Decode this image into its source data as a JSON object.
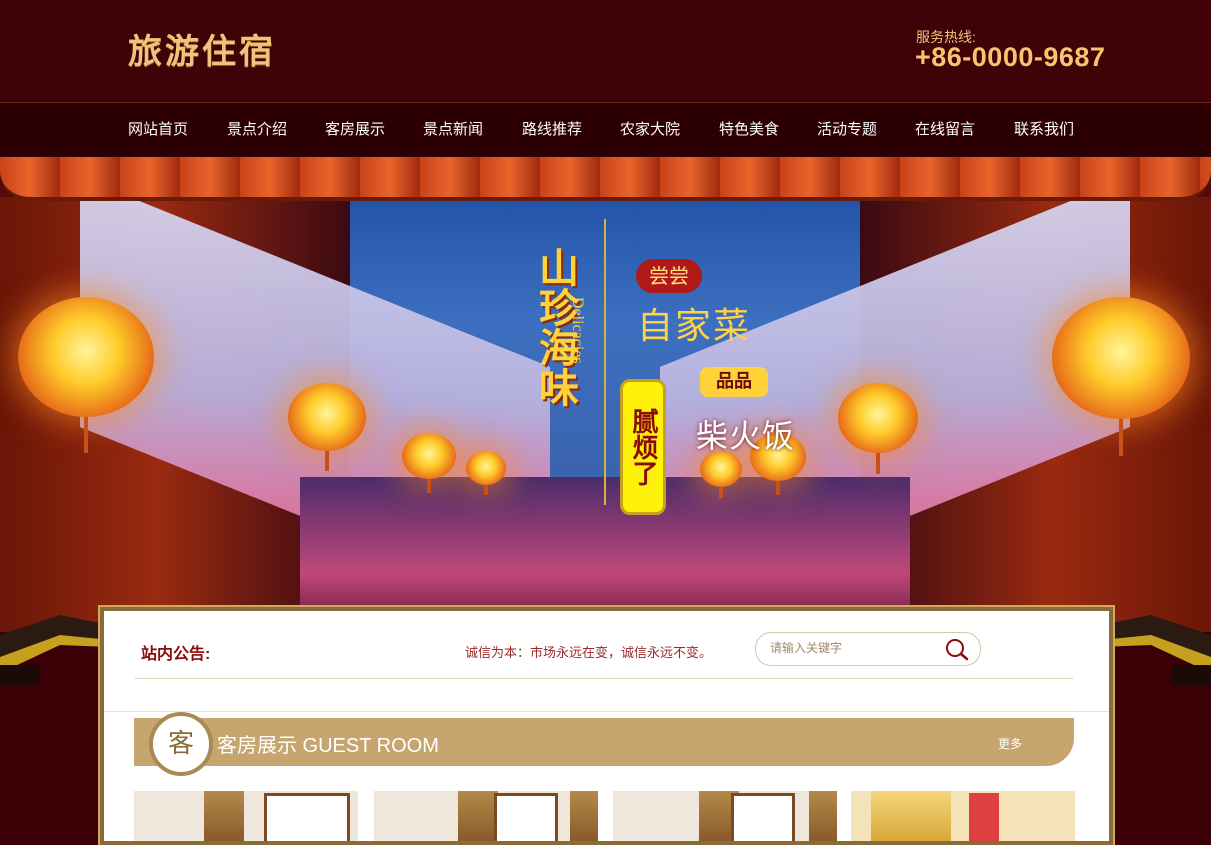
{
  "header": {
    "logo": "旅游住宿",
    "hotline_label": "服务热线:",
    "hotline_number": "+86-0000-9687"
  },
  "nav": {
    "items": [
      "网站首页",
      "景点介绍",
      "客房展示",
      "景点新闻",
      "路线推荐",
      "农家大院",
      "特色美食",
      "活动专题",
      "在线留言",
      "联系我们"
    ]
  },
  "banner": {
    "left_text": "山珍海味",
    "left_text_en": "Delicacies",
    "badge_top": "尝尝",
    "tagline": "自家菜",
    "scroll_text": "腻烦了",
    "badge_mid": "品品",
    "dish": "柴火饭"
  },
  "notice": {
    "label": "站内公告:",
    "text": "诚信为本：市场永远在变，诚信永远不变。"
  },
  "search": {
    "placeholder": "请输入关键字",
    "icon": "search-icon"
  },
  "section": {
    "icon_char": "客",
    "title": "客房展示 GUEST ROOM",
    "more": "更多"
  },
  "colors": {
    "header_bg": "#3e0207",
    "nav_bg": "#2c0003",
    "gold": "#f0c27c",
    "section_bar": "#c6a56f",
    "notice_red": "#8b0a0a"
  }
}
